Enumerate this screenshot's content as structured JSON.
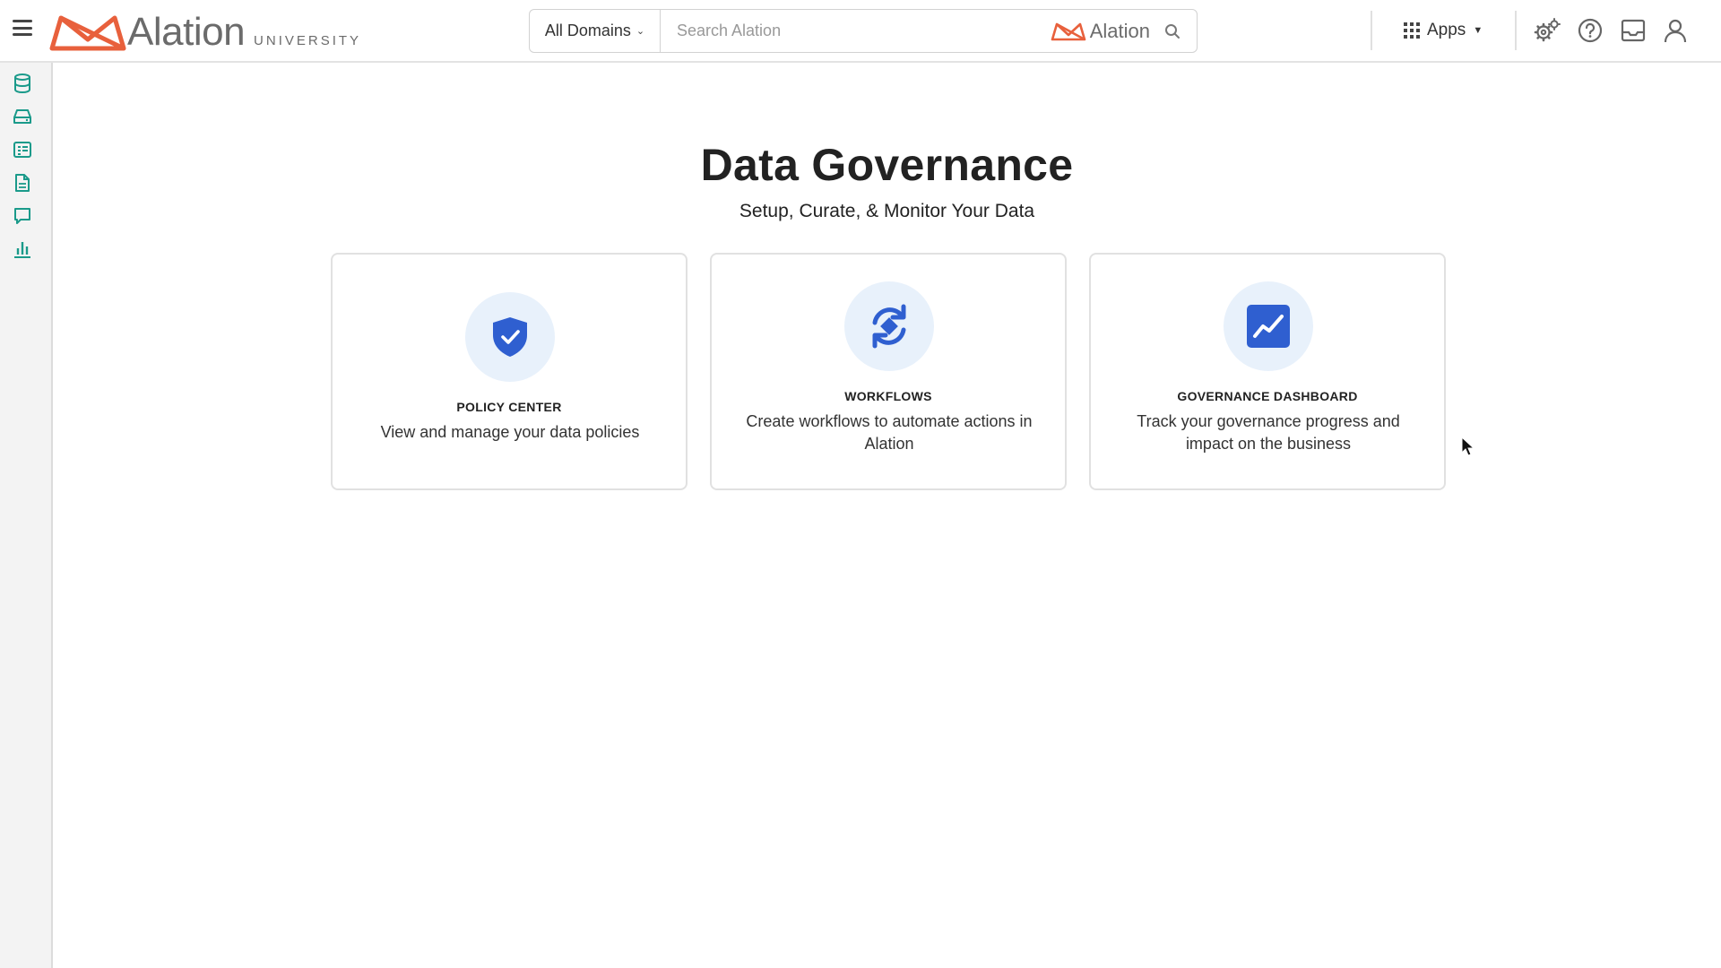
{
  "header": {
    "logo_word": "Alation",
    "logo_sub": "UNIVERSITY",
    "domain_select": "All Domains",
    "search_placeholder": "Search Alation",
    "search_brand": "Alation",
    "apps_label": "Apps"
  },
  "icons": {
    "menu": "hamburger-icon",
    "settings": "gear-cluster-icon",
    "help": "question-circle-icon",
    "inbox": "inbox-icon",
    "user": "user-icon"
  },
  "sidebar": {
    "items": [
      {
        "name": "database",
        "icon": "database-icon"
      },
      {
        "name": "storage",
        "icon": "hard-drive-icon"
      },
      {
        "name": "catalog",
        "icon": "table-list-icon"
      },
      {
        "name": "documents",
        "icon": "document-icon"
      },
      {
        "name": "conversations",
        "icon": "chat-icon"
      },
      {
        "name": "analytics",
        "icon": "bar-chart-icon"
      }
    ]
  },
  "main": {
    "title": "Data Governance",
    "subtitle": "Setup, Curate, & Monitor Your Data",
    "cards": [
      {
        "title": "POLICY CENTER",
        "description": "View and manage your data policies",
        "icon": "shield-check-icon"
      },
      {
        "title": "WORKFLOWS",
        "description": "Create workflows to automate actions in Alation",
        "icon": "sync-arrows-icon"
      },
      {
        "title": "GOVERNANCE DASHBOARD",
        "description": "Track your governance progress and impact on the business",
        "icon": "trend-chart-icon"
      }
    ]
  },
  "colors": {
    "brand_orange": "#e8603c",
    "rail_teal": "#1a9a8a",
    "card_icon_blue": "#2f5fd0",
    "card_icon_bg": "#e8f1fb"
  }
}
